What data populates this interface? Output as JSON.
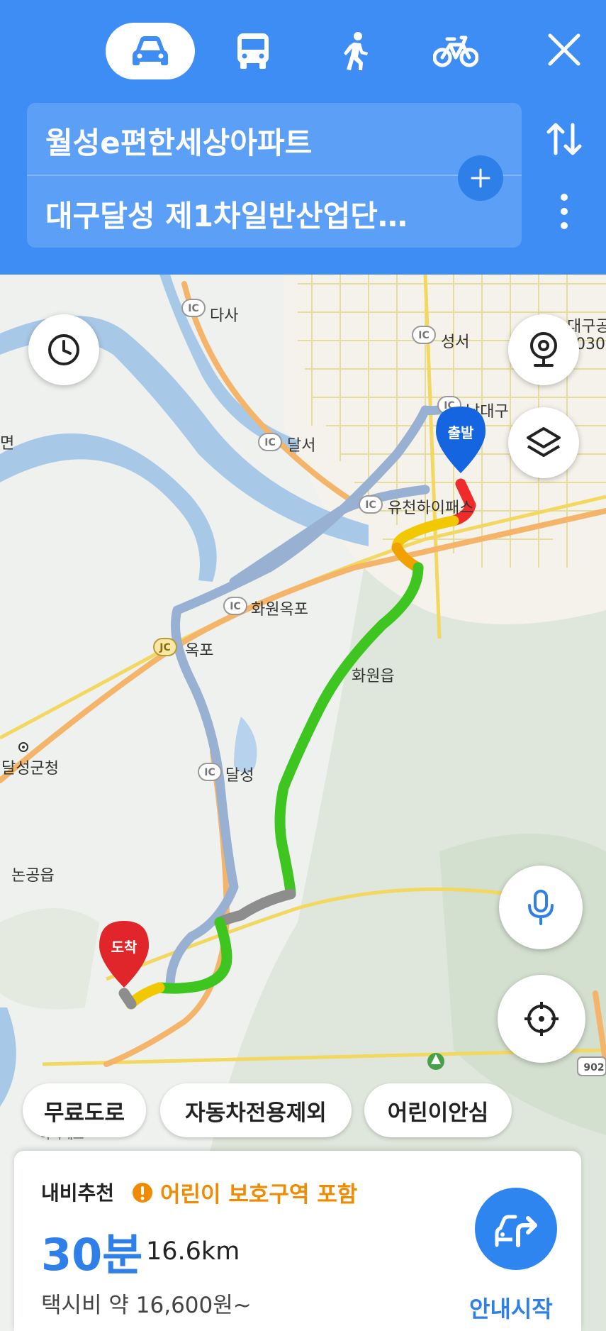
{
  "modes": [
    {
      "icon": "car-icon",
      "active": true
    },
    {
      "icon": "bus-icon",
      "active": false
    },
    {
      "icon": "walk-icon",
      "active": false
    },
    {
      "icon": "bicycle-icon",
      "active": false
    }
  ],
  "route": {
    "origin": "월성e편한세상아파트",
    "destination": "대구달성 제1차일반산업단…"
  },
  "map": {
    "labels": {
      "dasa": "다사",
      "seongseo": "성서",
      "nam_daegu": "남대구",
      "dalseo": "달서",
      "yucheon_hipass": "유천하이패스",
      "hwawon_okpo": "화원옥포",
      "okpo": "옥포",
      "hwawon_eup": "화원읍",
      "dalseong_ic": "달성",
      "dalseong_gun_office": "달성군청",
      "nongong_eup": "논공읍",
      "myeon": "면",
      "daegu_partial": "대구공",
      "num_partial": "030",
      "road_902": "902",
      "hipass_bottom": "하이패스",
      "ic": "IC",
      "jc": "JC"
    },
    "start_marker": "출발",
    "end_marker": "도착"
  },
  "options": [
    "무료도로",
    "자동차전용제외",
    "어린이안심"
  ],
  "result": {
    "title": "내비추천",
    "warning": "어린이 보호구역 포함",
    "time": "30분",
    "distance": "16.6km",
    "fare": "택시비 약 16,600원~",
    "start_label": "안내시작"
  },
  "colors": {
    "header": "#3d8df5",
    "accent": "#2f7fe8",
    "warning": "#f08a00",
    "route_green": "#3ec51f",
    "route_yellow": "#f2c900",
    "route_red": "#ef2b2b",
    "start_pin": "#1565e0",
    "end_pin": "#e0252b"
  }
}
